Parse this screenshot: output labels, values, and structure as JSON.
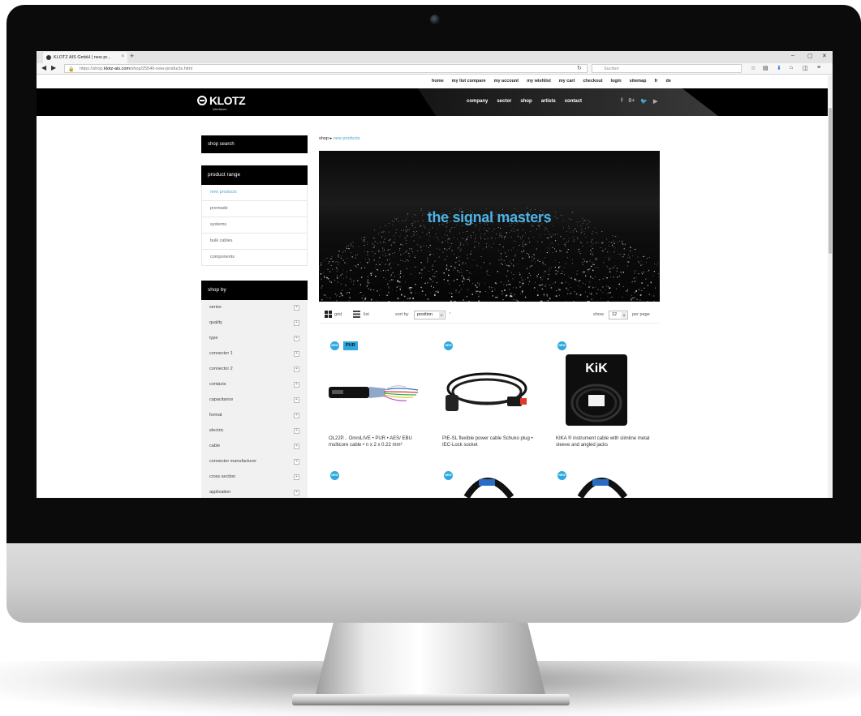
{
  "browser": {
    "tab_title": "KLOTZ AIS GmbH | new pr...",
    "tab_close": "×",
    "new_tab": "+",
    "url_prefix": "https://shop.",
    "url_domain": "klotz-ais.com",
    "url_path": "/shop/25540-new-products.html",
    "search_placeholder": "Suchen",
    "win_minimize": "–",
    "win_maximize": "▢",
    "win_close": "✕"
  },
  "toplinks": [
    "home",
    "my list compare",
    "my account",
    "my wishlist",
    "my cart",
    "checkout",
    "login",
    "sitemap",
    "fr",
    "de"
  ],
  "header": {
    "logo": "KLOTZ",
    "logo_sub": "interfaces",
    "nav": [
      "company",
      "sector",
      "shop",
      "artists",
      "contact"
    ],
    "social": [
      "f",
      "8+",
      "🐦",
      "▶"
    ]
  },
  "sidebar": {
    "shop_search": "shop search",
    "range_title": "product range",
    "range_items": [
      "new products",
      "premade",
      "systems",
      "bulk cables",
      "components"
    ],
    "shopby_title": "shop by",
    "shopby_items": [
      "series",
      "quality",
      "type",
      "connector 1",
      "connector 2",
      "contacts",
      "capacitance",
      "format",
      "electric",
      "cable",
      "connector manufacturer",
      "cross section",
      "application"
    ],
    "expand_symbol": "+"
  },
  "breadcrumb": {
    "root": "shop",
    "separator": "▸",
    "current": "new products"
  },
  "banner": {
    "title": "the signal masters"
  },
  "toolbar": {
    "grid_label": "grid",
    "list_label": "list",
    "sort_label": "sort by",
    "sort_value": "position",
    "sort_dir": "↑",
    "show_label": "show",
    "show_value": "12",
    "per_page": "per page"
  },
  "products": [
    {
      "name": "OL22P... OmniLIVE • PUR • AES/ EBU multicore cable • n x 2 x 0.22 mm²",
      "badge": "NEW",
      "extra_badge": "PUR"
    },
    {
      "name": "PIE-SL flexible power cable Schuko plug • IEC-Lock socket",
      "badge": "NEW"
    },
    {
      "name": "KIKA ® instrument cable with slimline metal sleeve and angled jacks",
      "badge": "NEW",
      "package_text": "KiK"
    },
    {
      "name": "",
      "badge": "NEW"
    },
    {
      "name": "",
      "badge": "NEW"
    },
    {
      "name": "",
      "badge": "NEW"
    }
  ],
  "colors": {
    "accent": "#2fa8e0",
    "header_bg": "#000000",
    "sidebar_bg": "#f1f1f1"
  }
}
